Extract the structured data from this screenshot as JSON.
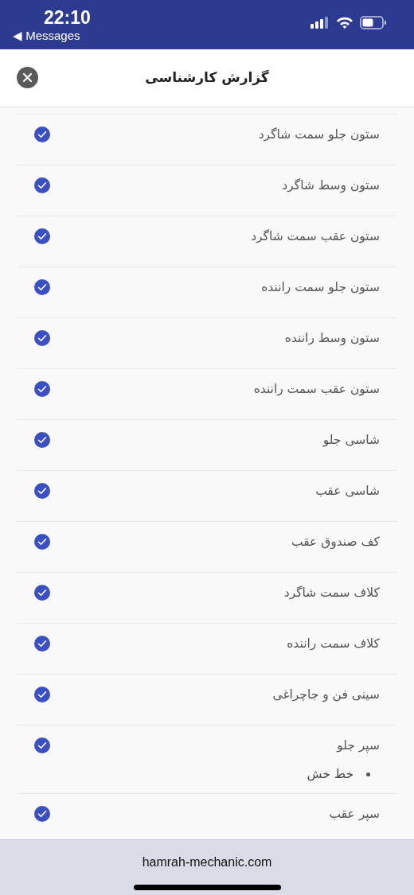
{
  "status_bar": {
    "time": "22:10",
    "back_label": "◀ Messages"
  },
  "header": {
    "title": "گزارش کارشناسی"
  },
  "items": [
    {
      "label": "ستون جلو سمت شاگرد",
      "checked": true
    },
    {
      "label": "ستون وسط شاگرد",
      "checked": true
    },
    {
      "label": "ستون عقب سمت شاگرد",
      "checked": true
    },
    {
      "label": "ستون جلو سمت راننده",
      "checked": true
    },
    {
      "label": "ستون وسط راننده",
      "checked": true
    },
    {
      "label": "ستون عقب سمت راننده",
      "checked": true
    },
    {
      "label": "شاسی جلو",
      "checked": true
    },
    {
      "label": "شاسی عقب",
      "checked": true
    },
    {
      "label": "کف صندوق عقب",
      "checked": true
    },
    {
      "label": "کلاف سمت شاگرد",
      "checked": true
    },
    {
      "label": "کلاف سمت راننده",
      "checked": true
    },
    {
      "label": "سینی فن و جاچراغی",
      "checked": true
    },
    {
      "label": "سپر جلو",
      "checked": true,
      "notes": [
        "خط خش"
      ]
    },
    {
      "label": "سپر عقب",
      "checked": true
    }
  ],
  "browser_bar": {
    "url": "hamrah-mechanic.com"
  }
}
